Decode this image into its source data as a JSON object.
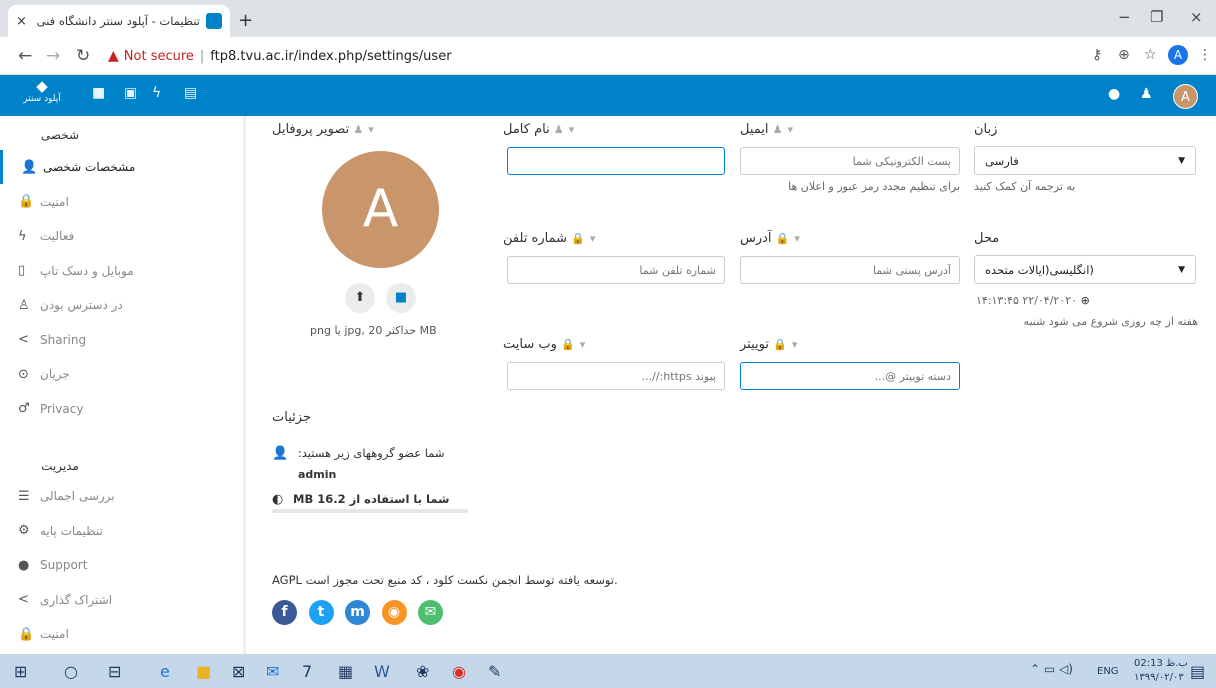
{
  "browser": {
    "tab_title": "تنظیمات - آپلود سنتر دانشگاه فنی",
    "tab_close": "×",
    "new_tab": "+",
    "not_secure": "Not secure",
    "separator": "|",
    "url": "ftp8.tvu.ac.ir/index.php/settings/user",
    "profile_letter": "A",
    "win_min": "−",
    "win_restore": "❐",
    "win_close": "×"
  },
  "header": {
    "logo_text": "آپلود سنتر",
    "avatar_letter": "A"
  },
  "sidebar": {
    "personal_heading": "شخصی",
    "personal_items": [
      {
        "label": "مشخصات شخصی",
        "icon": "user-icon",
        "glyph": "👤"
      },
      {
        "label": "امنیت",
        "icon": "lock-icon",
        "glyph": "🔒"
      },
      {
        "label": "فعالیت",
        "icon": "activity-icon",
        "glyph": "ϟ"
      },
      {
        "label": "موبایل و دسک تاپ",
        "icon": "phone-icon",
        "glyph": "▯"
      },
      {
        "label": "در دسترس بودن",
        "icon": "accessibility-icon",
        "glyph": "♙"
      },
      {
        "label": "Sharing",
        "icon": "share-icon",
        "glyph": "<"
      },
      {
        "label": "جریان",
        "icon": "flow-icon",
        "glyph": "⊙"
      },
      {
        "label": "Privacy",
        "icon": "privacy-icon",
        "glyph": "♂"
      }
    ],
    "admin_heading": "مدیریت",
    "admin_items": [
      {
        "label": "بررسی اجمالی",
        "icon": "overview-icon",
        "glyph": "☰"
      },
      {
        "label": "تنظیمات پایه",
        "icon": "gear-icon",
        "glyph": "⚙"
      },
      {
        "label": "Support",
        "icon": "support-icon",
        "glyph": "●"
      },
      {
        "label": "اشتراک گذاری",
        "icon": "share-icon",
        "glyph": "<"
      },
      {
        "label": "امنیت",
        "icon": "lock-icon",
        "glyph": "🔒"
      }
    ]
  },
  "profile": {
    "picture_label": "تصویر پروفایل",
    "avatar_letter": "A",
    "upload_glyph": "⬆",
    "folder_glyph": "■",
    "size_hint": "png یا jpg, 20 حداکثر MB"
  },
  "fields": {
    "fullname_label": "نام کامل",
    "fullname_value": "",
    "email_label": "ایمیل",
    "email_placeholder": "پست الکترونیکی شما",
    "email_help": "برای تنظیم مجدد رمز عبور و اعلان ها",
    "language_label": "زبان",
    "language_value": "فارسی",
    "language_help": "به ترجمه آن کمک کنید",
    "phone_label": "شماره تلفن",
    "phone_placeholder": "شماره تلفن شما",
    "address_label": "آدرس",
    "address_placeholder": "آدرس پستی شما",
    "locale_label": "محل",
    "locale_value": "(انگلیسی(ایالات متحده",
    "locale_time": "۲۲/۰۴/۲۰۲۰ ۱۴:۱۳:۴۵",
    "locale_help": "هفته از چه روزی شروع می شود شنبه",
    "website_label": "وب سایت",
    "website_placeholder": "پیوند https://...",
    "twitter_label": "توییتر",
    "twitter_placeholder": "دسته توییتر @..."
  },
  "details": {
    "heading": "جزئیات",
    "groups_text": ":شما عضو گروههای زیر هستید",
    "group_name": "admin",
    "quota_text": "MB شما با استفاده از 16.2",
    "quota_used_fraction": 0.0
  },
  "footer": {
    "text": "AGPL توسعه یافته توسط انجمن نکست کلود ، کد منبع تحت مجوز است.",
    "social": [
      {
        "name": "facebook",
        "glyph": "f",
        "color": "#3b5998"
      },
      {
        "name": "twitter",
        "glyph": "t",
        "color": "#1da1f2"
      },
      {
        "name": "mastodon",
        "glyph": "m",
        "color": "#3088d4"
      },
      {
        "name": "rss",
        "glyph": "◉",
        "color": "#f79422"
      },
      {
        "name": "mail",
        "glyph": "✉",
        "color": "#4cbe6f"
      }
    ]
  },
  "taskbar": {
    "lang": "ENG",
    "time": "02:13 ب.ظ",
    "date": "۱۳۹۹/۰۲/۰۳"
  },
  "colors": {
    "brand": "#0082c9",
    "avatar": "#c9956b"
  }
}
